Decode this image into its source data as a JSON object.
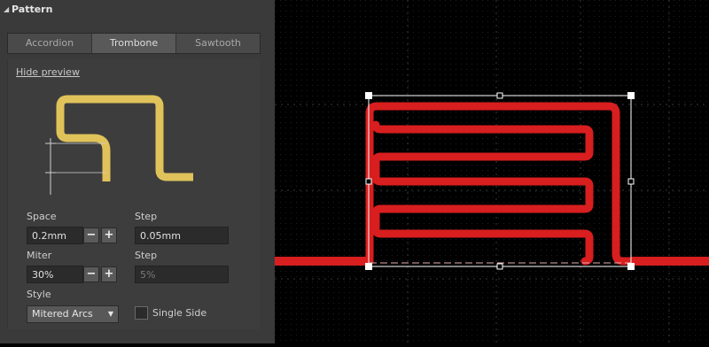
{
  "panel": {
    "title": "Pattern",
    "tabs": [
      "Accordion",
      "Trombone",
      "Sawtooth"
    ],
    "active_tab": "Trombone",
    "preview_link": "Hide preview",
    "space": {
      "label": "Space",
      "value": "0.2mm"
    },
    "step1": {
      "label": "Step",
      "value": "0.05mm"
    },
    "miter": {
      "label": "Miter",
      "value": "30%"
    },
    "step2": {
      "label": "Step",
      "value": "5%"
    },
    "style": {
      "label": "Style",
      "selected": "Mitered Arcs"
    },
    "single_side": {
      "label": "Single Side",
      "checked": false
    },
    "minus": "−",
    "plus": "+"
  },
  "colors": {
    "panel_bg": "#3a3a3a",
    "preview_trace": "#e0c25a",
    "trace": "#d81e1e",
    "canvas_bg": "#000000"
  }
}
